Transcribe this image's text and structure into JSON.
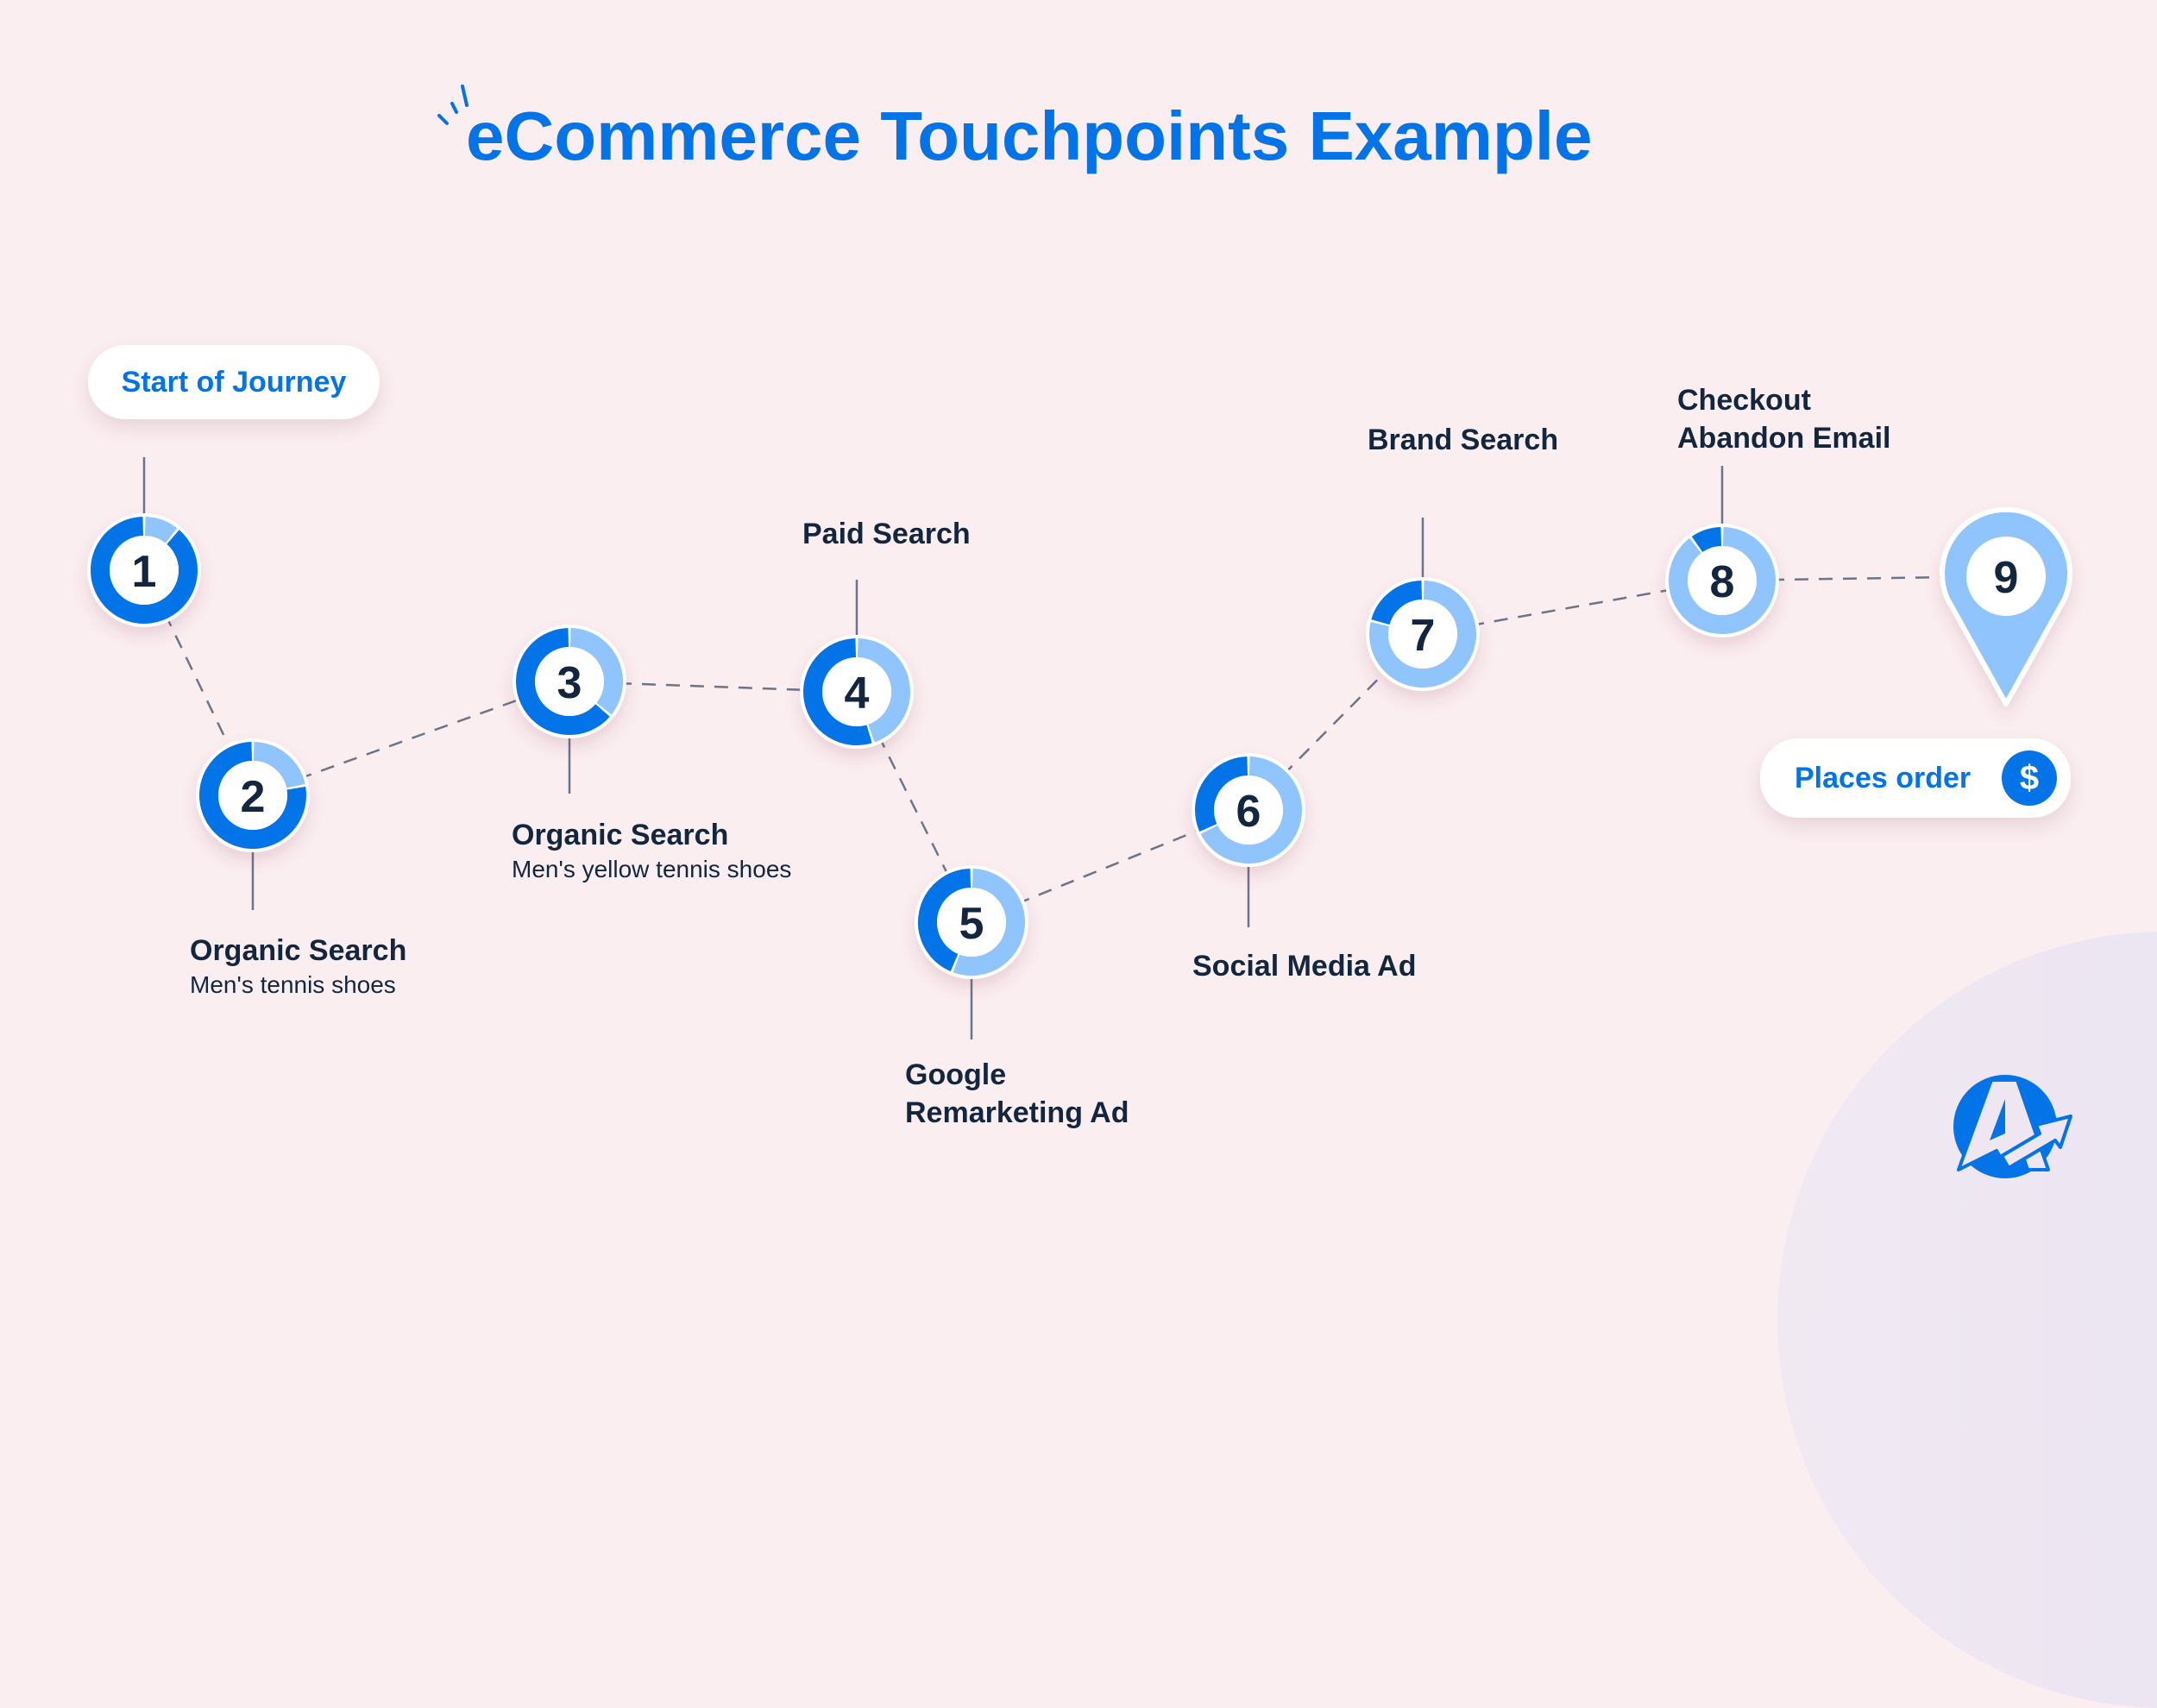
{
  "title": "eCommerce Touchpoints Example",
  "start_pill": "Start of Journey",
  "end_pill": {
    "label": "Places order",
    "icon": "dollar-icon",
    "glyph": "$"
  },
  "colors": {
    "primary": "#0274e8",
    "light": "#90c4fc",
    "text": "#12263f",
    "connector": "#6b7587",
    "background": "#fbeef0"
  },
  "touchpoints": [
    {
      "step": "1",
      "title": "",
      "subtitle": "",
      "light_share": 0.11
    },
    {
      "step": "2",
      "title": "Organic Search",
      "subtitle": "Men's tennis shoes",
      "light_share": 0.22
    },
    {
      "step": "3",
      "title": "Organic Search",
      "subtitle": "Men's yellow tennis shoes",
      "light_share": 0.36
    },
    {
      "step": "4",
      "title": "Paid Search",
      "subtitle": "",
      "light_share": 0.45
    },
    {
      "step": "5",
      "title": "Google",
      "title2": "Remarketing Ad",
      "subtitle": "",
      "light_share": 0.56
    },
    {
      "step": "6",
      "title": "Social Media Ad",
      "subtitle": "",
      "light_share": 0.68
    },
    {
      "step": "7",
      "title": "Brand Search",
      "subtitle": "",
      "light_share": 0.79
    },
    {
      "step": "8",
      "title": "Checkout",
      "title2": "Abandon Email",
      "subtitle": "",
      "light_share": 0.9
    },
    {
      "step": "9",
      "title": "",
      "subtitle": "",
      "light_share": 1.0
    }
  ],
  "logo": {
    "name": "AgencyAnalytics logo"
  }
}
